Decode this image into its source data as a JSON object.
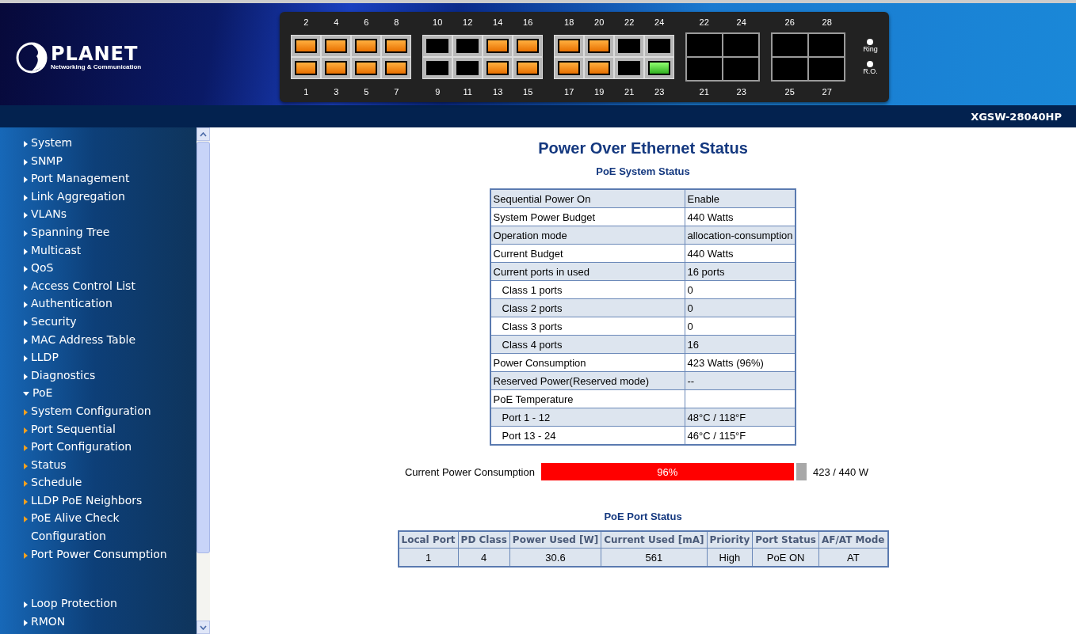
{
  "brand": {
    "name": "PLANET",
    "tagline": "Networking & Communication"
  },
  "port_panel": {
    "groups": [
      {
        "kind": "rj45",
        "top": [
          {
            "label": "2",
            "poe": true,
            "link": true
          },
          {
            "label": "4",
            "poe": true,
            "link": true
          },
          {
            "label": "6",
            "poe": true,
            "link": true
          },
          {
            "label": "8",
            "poe": true,
            "link": true
          }
        ],
        "bottom": [
          {
            "label": "1",
            "poe": true,
            "link": true
          },
          {
            "label": "3",
            "poe": true,
            "link": true
          },
          {
            "label": "5",
            "poe": true,
            "link": true
          },
          {
            "label": "7",
            "poe": true,
            "link": true
          }
        ]
      },
      {
        "kind": "rj45",
        "top": [
          {
            "label": "10",
            "poe": false,
            "link": false
          },
          {
            "label": "12",
            "poe": false,
            "link": false
          },
          {
            "label": "14",
            "poe": true,
            "link": true
          },
          {
            "label": "16",
            "poe": true,
            "link": true
          }
        ],
        "bottom": [
          {
            "label": "9",
            "poe": false,
            "link": false
          },
          {
            "label": "11",
            "poe": false,
            "link": false
          },
          {
            "label": "13",
            "poe": true,
            "link": true
          },
          {
            "label": "15",
            "poe": true,
            "link": true
          }
        ]
      },
      {
        "kind": "rj45",
        "top": [
          {
            "label": "18",
            "poe": true,
            "link": true
          },
          {
            "label": "20",
            "poe": true,
            "link": true
          },
          {
            "label": "22",
            "poe": false,
            "link": false
          },
          {
            "label": "24",
            "poe": false,
            "link": false
          }
        ],
        "bottom": [
          {
            "label": "17",
            "poe": true,
            "link": true
          },
          {
            "label": "19",
            "poe": true,
            "link": true
          },
          {
            "label": "21",
            "poe": false,
            "link": false
          },
          {
            "label": "23",
            "poe": false,
            "link": true
          }
        ]
      },
      {
        "kind": "sfp",
        "top": [
          {
            "label": "22",
            "link": false
          },
          {
            "label": "24",
            "link": false
          }
        ],
        "bottom": [
          {
            "label": "21",
            "link": false
          },
          {
            "label": "23",
            "link": false
          }
        ]
      },
      {
        "kind": "sfp",
        "top": [
          {
            "label": "26",
            "link": false
          },
          {
            "label": "28",
            "link": false
          }
        ],
        "bottom": [
          {
            "label": "25",
            "link": false
          },
          {
            "label": "27",
            "link": false
          }
        ]
      }
    ],
    "leds": [
      {
        "label": "Ring"
      },
      {
        "label": "R.O."
      }
    ]
  },
  "model": "XGSW-28040HP",
  "sidebar": {
    "items": [
      {
        "label": "System",
        "expanded": false
      },
      {
        "label": "SNMP",
        "expanded": false
      },
      {
        "label": "Port Management",
        "expanded": false
      },
      {
        "label": "Link Aggregation",
        "expanded": false
      },
      {
        "label": "VLANs",
        "expanded": false
      },
      {
        "label": "Spanning Tree",
        "expanded": false
      },
      {
        "label": "Multicast",
        "expanded": false
      },
      {
        "label": "QoS",
        "expanded": false
      },
      {
        "label": "Access Control List",
        "expanded": false
      },
      {
        "label": "Authentication",
        "expanded": false
      },
      {
        "label": "Security",
        "expanded": false
      },
      {
        "label": "MAC Address Table",
        "expanded": false
      },
      {
        "label": "LLDP",
        "expanded": false
      },
      {
        "label": "Diagnostics",
        "expanded": false
      },
      {
        "label": "PoE",
        "expanded": true,
        "children": [
          {
            "label": "System Configuration"
          },
          {
            "label": "Port Sequential"
          },
          {
            "label": "Port Configuration"
          },
          {
            "label": "Status"
          },
          {
            "label": "Schedule"
          },
          {
            "label": "LLDP PoE Neighbors"
          },
          {
            "label": "PoE Alive Check Configuration"
          },
          {
            "label": "Port Power Consumption"
          }
        ]
      },
      {
        "label": "Loop Protection",
        "expanded": false
      },
      {
        "label": "RMON",
        "expanded": false
      }
    ]
  },
  "title": "Power Over Ethernet Status",
  "system_status": {
    "title": "PoE System Status",
    "rows": [
      {
        "label": "Sequential Power On",
        "value": "Enable"
      },
      {
        "label": "System Power Budget",
        "value": "440 Watts"
      },
      {
        "label": "Operation mode",
        "value": "allocation-consumption"
      },
      {
        "label": "Current Budget",
        "value": "440 Watts"
      },
      {
        "label": "Current ports in used",
        "value": "16 ports",
        "children": [
          {
            "label": "Class 1 ports",
            "value": "0"
          },
          {
            "label": "Class 2 ports",
            "value": "0"
          },
          {
            "label": "Class 3 ports",
            "value": "0"
          },
          {
            "label": "Class 4 ports",
            "value": "16"
          }
        ]
      },
      {
        "label": "Power Consumption",
        "value": "423 Watts (96%)"
      },
      {
        "label": "Reserved Power(Reserved mode)",
        "value": "--"
      },
      {
        "label": "PoE Temperature",
        "children": [
          {
            "label": "Port 1 - 12",
            "value": "48°C / 118°F"
          },
          {
            "label": "Port 13 - 24",
            "value": "46°C / 115°F"
          }
        ]
      }
    ]
  },
  "consumption": {
    "label": "Current Power Consumption",
    "level": 0.96,
    "percent": "96%",
    "reading": "423 / 440 W"
  },
  "port_status": {
    "title": "PoE Port Status",
    "columns": [
      "Local Port",
      "PD Class",
      "Power Used [W]",
      "Current Used [mA]",
      "Priority",
      "Port Status",
      "AF/AT Mode"
    ],
    "rows": [
      [
        "1",
        "4",
        "30.6",
        "561",
        "High",
        "PoE ON",
        "AT"
      ]
    ]
  }
}
